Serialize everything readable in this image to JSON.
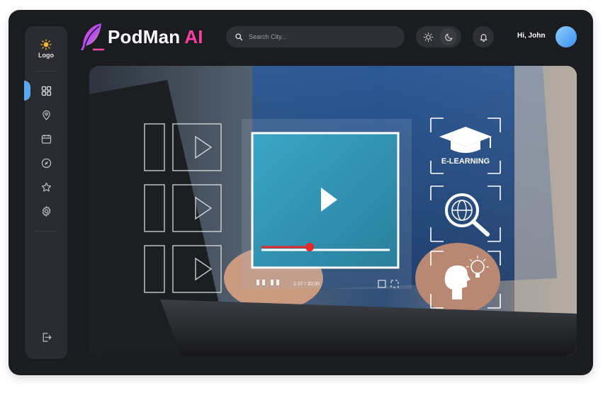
{
  "sidebar": {
    "logo_label": "Logo",
    "items": [
      {
        "name": "dashboard",
        "icon": "grid-icon",
        "active": true
      },
      {
        "name": "location",
        "icon": "map-pin-icon"
      },
      {
        "name": "calendar",
        "icon": "calendar-icon"
      },
      {
        "name": "explore",
        "icon": "compass-icon"
      },
      {
        "name": "favorites",
        "icon": "star-icon"
      },
      {
        "name": "settings",
        "icon": "gear-icon"
      }
    ],
    "logout_icon": "logout-icon"
  },
  "header": {
    "brand_name": "PodMan",
    "brand_suffix": "AI",
    "search_placeholder": "Search City...",
    "greeting": "Hi, John"
  },
  "hero": {
    "card_label": "E-LEARNING",
    "player_time": "1:37 / 30:00"
  },
  "colors": {
    "accent": "#5aa8f0",
    "brand_pink": "#ff3fa0",
    "background": "#1b1c20",
    "panel": "#2a2c31"
  }
}
